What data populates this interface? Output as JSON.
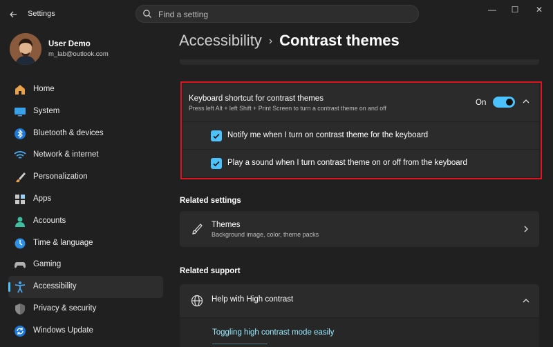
{
  "window": {
    "title": "Settings",
    "controls": {
      "minimize": "—",
      "maximize": "☐",
      "close": "✕"
    }
  },
  "search": {
    "placeholder": "Find a setting"
  },
  "user": {
    "name": "User Demo",
    "email": "m_lab@outlook.com"
  },
  "sidebar": {
    "items": [
      {
        "label": "Home",
        "icon": "home-icon"
      },
      {
        "label": "System",
        "icon": "monitor-icon"
      },
      {
        "label": "Bluetooth & devices",
        "icon": "bluetooth-icon"
      },
      {
        "label": "Network & internet",
        "icon": "wifi-icon"
      },
      {
        "label": "Personalization",
        "icon": "brush-icon"
      },
      {
        "label": "Apps",
        "icon": "apps-icon"
      },
      {
        "label": "Accounts",
        "icon": "person-icon"
      },
      {
        "label": "Time & language",
        "icon": "globe-clock-icon"
      },
      {
        "label": "Gaming",
        "icon": "gamepad-icon"
      },
      {
        "label": "Accessibility",
        "icon": "accessibility-icon",
        "active": true
      },
      {
        "label": "Privacy & security",
        "icon": "shield-icon"
      },
      {
        "label": "Windows Update",
        "icon": "update-icon"
      }
    ]
  },
  "breadcrumb": {
    "parent": "Accessibility",
    "separator": "›",
    "current": "Contrast themes"
  },
  "shortcut": {
    "title": "Keyboard shortcut for contrast themes",
    "description": "Press left Alt + left Shift + Print Screen to turn a contrast theme on and off",
    "toggle_state": "On",
    "toggle_on": true,
    "options": [
      {
        "label": "Notify me when I turn on contrast theme for the keyboard",
        "checked": true
      },
      {
        "label": "Play a sound when I turn contrast theme on or off from the keyboard",
        "checked": true
      }
    ]
  },
  "related_settings": {
    "heading": "Related settings",
    "themes": {
      "title": "Themes",
      "description": "Background image, color, theme packs"
    }
  },
  "related_support": {
    "heading": "Related support",
    "item": {
      "title": "Help with High contrast",
      "link": "Toggling high contrast mode easily"
    }
  },
  "colors": {
    "accent": "#4cc2ff",
    "highlight_border": "#e0141e",
    "link": "#99ebff",
    "background": "#202020",
    "card": "#2b2b2b"
  }
}
